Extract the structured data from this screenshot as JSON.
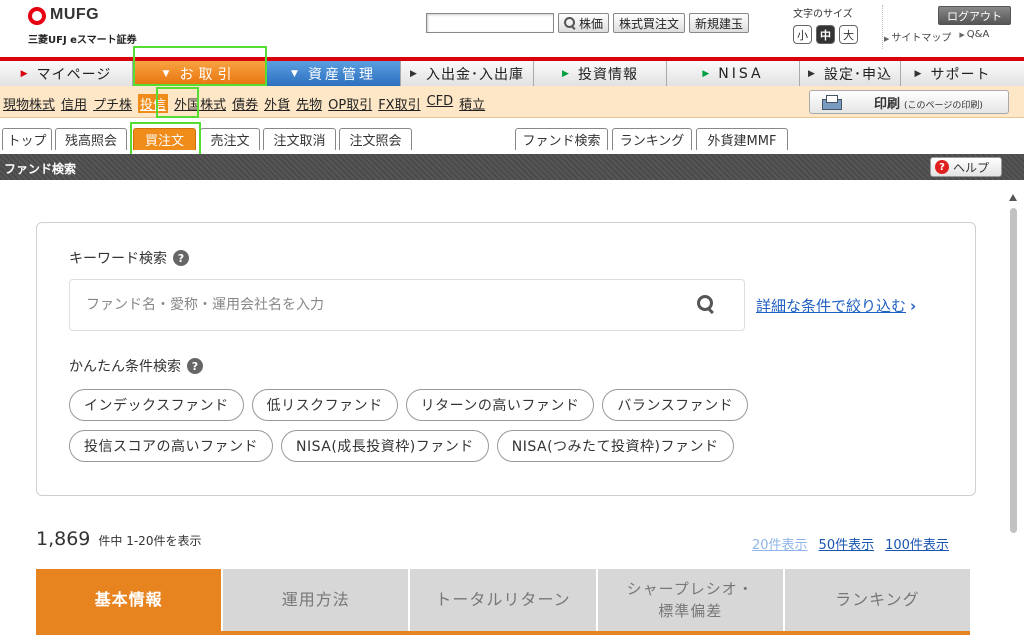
{
  "header": {
    "logo_text": "MUFG",
    "logo_sub": "三菱UFJ eスマート証券",
    "stock_search_value": "",
    "stock_price_label": "株価",
    "stock_order_label": "株式買注文",
    "margin_new_label": "新規建玉",
    "font_size_label": "文字のサイズ",
    "font_sizes": [
      "小",
      "中",
      "大"
    ],
    "logout_label": "ログアウト",
    "links": [
      "サイトマップ",
      "Q&A"
    ]
  },
  "main_nav": [
    "マイページ",
    "お取引",
    "資産管理",
    "入出金･入出庫",
    "投資情報",
    "NISA",
    "設定･申込",
    "サポート"
  ],
  "sub_nav": {
    "links": [
      "現物株式",
      "信用",
      "プチ株",
      "投信",
      "外国株式",
      "債券",
      "外貨",
      "先物",
      "OP取引",
      "FX取引",
      "CFD",
      "積立"
    ],
    "active_index": 3,
    "print_label": "印刷",
    "print_sub": "(このページの印刷)"
  },
  "tabs": [
    "トップ",
    "残高照会",
    "買注文",
    "売注文",
    "注文取消",
    "注文照会",
    "ファンド検索",
    "ランキング",
    "外貨建MMF"
  ],
  "title_bar": {
    "title": "ファンド検索",
    "help_label": "ヘルプ"
  },
  "search": {
    "keyword_label": "キーワード検索",
    "keyword_placeholder": "ファンド名・愛称・運用会社名を入力",
    "keyword_value": "",
    "detail_link": "詳細な条件で絞り込む",
    "easy_label": "かんたん条件検索",
    "chips_row1": [
      "インデックスファンド",
      "低リスクファンド",
      "リターンの高いファンド",
      "バランスファンド"
    ],
    "chips_row2": [
      "投信スコアの高いファンド",
      "NISA(成長投資枠)ファンド",
      "NISA(つみたて投資枠)ファンド"
    ]
  },
  "results": {
    "count": "1,869",
    "count_text": "件中 1-20件を表示",
    "per_page": [
      "20件表示",
      "50件表示",
      "100件表示"
    ],
    "view_tabs": [
      "基本情報",
      "運用方法",
      "トータルリターン",
      "シャープレシオ・標準偏差",
      "ランキング"
    ]
  },
  "colors": {
    "brand_red": "#d8000c",
    "accent_orange": "#e8841f",
    "accent_blue": "#2b6fbf",
    "link_blue": "#2060c0"
  }
}
